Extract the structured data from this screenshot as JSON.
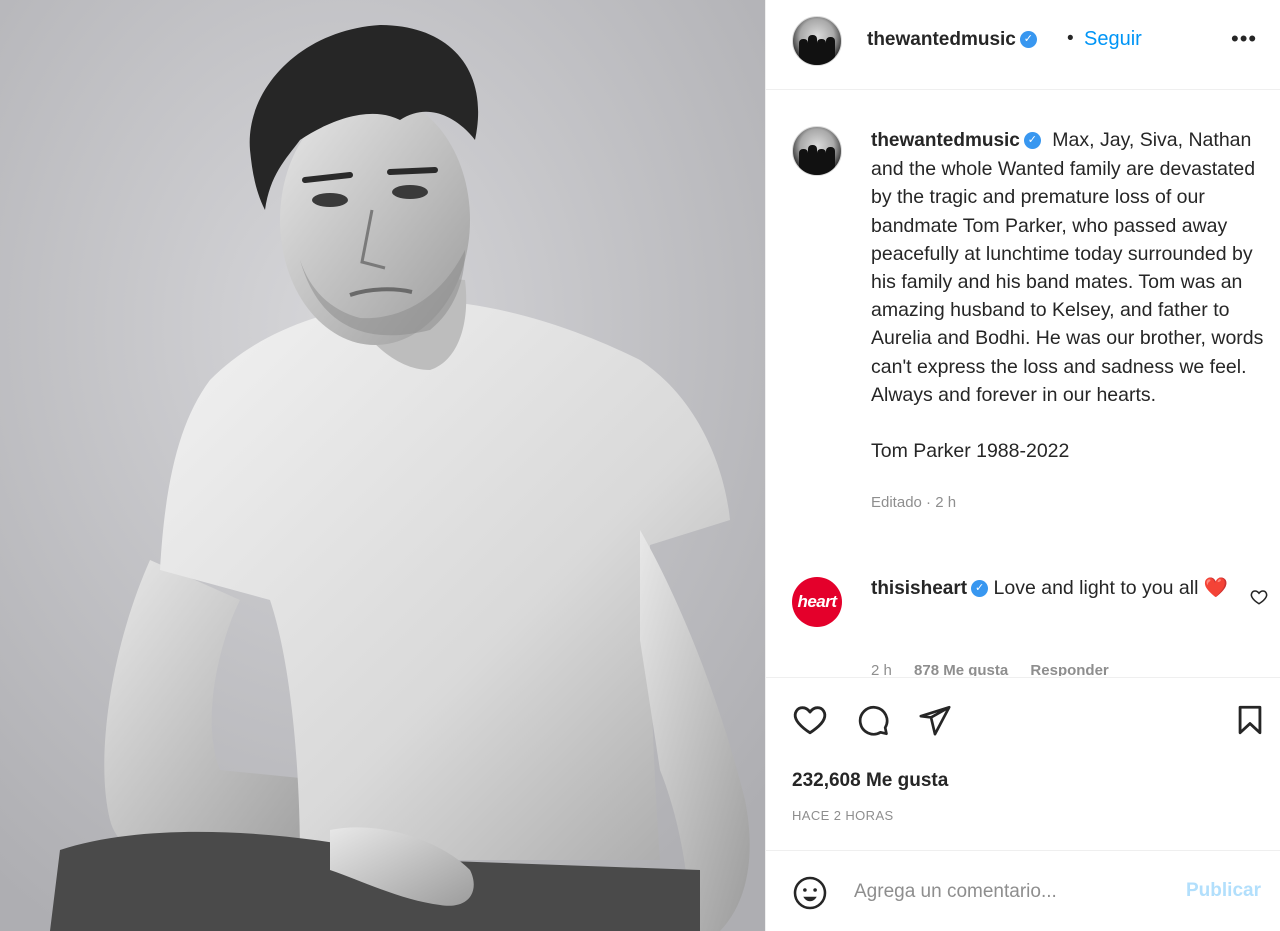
{
  "post": {
    "username": "thewantedmusic",
    "verified_mark": "✓",
    "separator": "•",
    "follow_label": "Seguir",
    "more_label": "•••"
  },
  "caption": {
    "username": "thewantedmusic",
    "text": "Max, Jay, Siva, Nathan and the whole Wanted family are devastated by the tragic and premature loss of our bandmate Tom Parker, who passed away peacefully at lunchtime today surrounded by his family and his band mates. Tom was an amazing husband to Kelsey, and father to Aurelia and Bodhi. He was our brother, words can't express the loss and sadness we feel. Always and forever in our hearts.",
    "signoff": "Tom Parker 1988-2022",
    "edited": "Editado · 2 h"
  },
  "comment": {
    "avatar_text": "heart",
    "username": "thisisheart",
    "text": "Love and light to you all",
    "emoji": "❤️",
    "meta_time": "2 h",
    "meta_likes": "878 Me gusta",
    "meta_reply": "Responder"
  },
  "actions": {
    "like_icon": "heart-outline-icon",
    "comment_icon": "comment-bubble-icon",
    "share_icon": "paper-plane-icon",
    "save_icon": "bookmark-icon",
    "likes_text": "232,608 Me gusta",
    "time_ago": "HACE 2 HORAS"
  },
  "add_comment": {
    "placeholder": "Agrega un comentario...",
    "post_label": "Publicar"
  },
  "colors": {
    "accent": "#0095f6",
    "verified": "#3897f0",
    "heart_red": "#ed4956",
    "brand_heart": "#e4002b",
    "muted": "#8e8e8e"
  }
}
